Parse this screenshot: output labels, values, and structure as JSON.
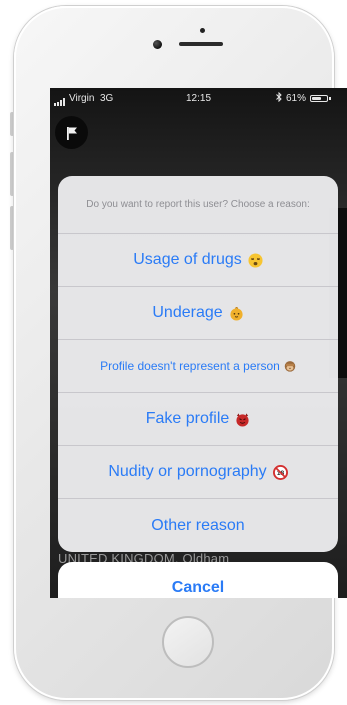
{
  "status_bar": {
    "carrier": "Virgin",
    "network": "3G",
    "time": "12:15",
    "battery_percent": "61%",
    "battery_level": 0.61
  },
  "action_sheet": {
    "title": "Do you want to report this user? Choose a reason:",
    "options": [
      {
        "label": "Usage of drugs",
        "icon": "dizzy-face-emoji"
      },
      {
        "label": "Underage",
        "icon": "baby-emoji"
      },
      {
        "label": "Profile doesn't represent a person",
        "icon": "see-no-evil-monkey-emoji"
      },
      {
        "label": "Fake profile",
        "icon": "devil-face-emoji"
      },
      {
        "label": "Nudity or pornography",
        "icon": "no-under-eighteen-emoji"
      },
      {
        "label": "Other reason",
        "icon": ""
      }
    ],
    "cancel_label": "Cancel"
  },
  "background": {
    "location_text": "UNITED KINGDOM, Oldham"
  },
  "colors": {
    "action_blue": "#2a7bf6",
    "sheet_background": "#ececee",
    "screen_background": "#1a1a1a"
  }
}
